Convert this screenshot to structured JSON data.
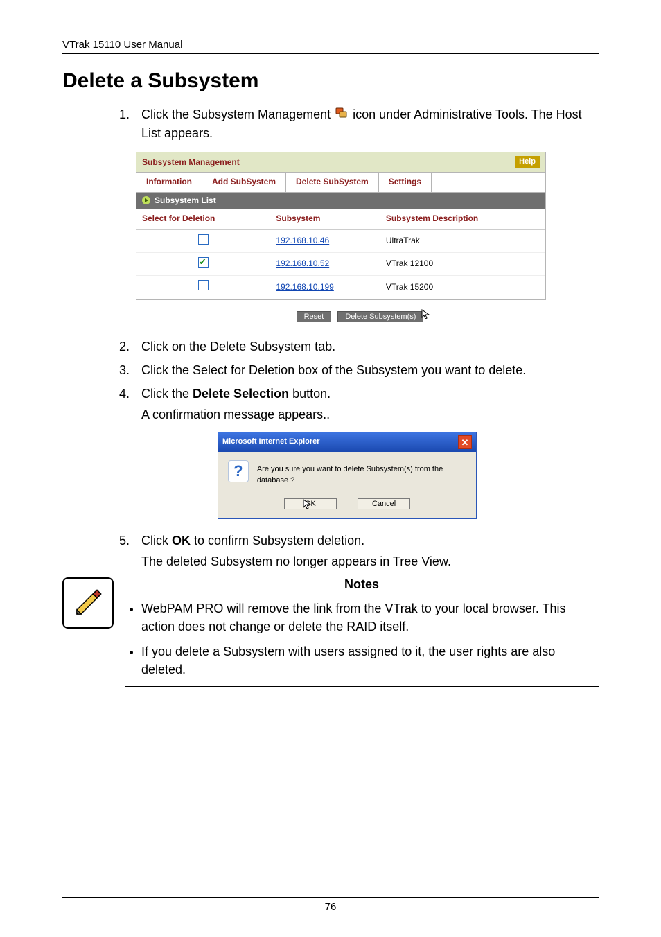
{
  "header": {
    "manual_title": "VTrak 15110 User Manual"
  },
  "section": {
    "title": "Delete a Subsystem"
  },
  "steps": {
    "s1_pre": "Click the Subsystem Management ",
    "s1_post": " icon under Administrative Tools. The Host List appears.",
    "s2": "Click on the Delete Subsystem tab.",
    "s3": "Click the Select for Deletion box of the Subsystem you want to delete.",
    "s4_a": "Click the ",
    "s4_b": "Delete Selection",
    "s4_c": " button.",
    "s4_sub": "A confirmation message appears..",
    "s5_a": "Click ",
    "s5_b": "OK",
    "s5_c": " to confirm Subsystem deletion.",
    "s5_sub": "The deleted Subsystem no longer appears in Tree View."
  },
  "panel": {
    "title": "Subsystem Management",
    "help": "Help",
    "tabs": {
      "info": "Information",
      "add": "Add SubSystem",
      "del": "Delete SubSystem",
      "settings": "Settings"
    },
    "listbar": "Subsystem List",
    "cols": {
      "select": "Select for Deletion",
      "subsystem": "Subsystem",
      "desc": "Subsystem Description"
    },
    "rows": [
      {
        "checked": false,
        "ip": "192.168.10.46",
        "desc": "UltraTrak"
      },
      {
        "checked": true,
        "ip": "192.168.10.52",
        "desc": "VTrak 12100"
      },
      {
        "checked": false,
        "ip": "192.168.10.199",
        "desc": "VTrak 15200"
      }
    ],
    "buttons": {
      "reset": "Reset",
      "delete": "Delete Subsystem(s)"
    }
  },
  "dialog": {
    "title": "Microsoft Internet Explorer",
    "message": "Are you sure you want to delete Subsystem(s) from the database ?",
    "ok": "OK",
    "cancel": "Cancel"
  },
  "notes": {
    "title": "Notes",
    "n1": "WebPAM PRO will remove the link from the VTrak to your local browser. This action does not change or delete the RAID itself.",
    "n2": "If you delete a Subsystem with users assigned to it, the user rights are also deleted."
  },
  "footer": {
    "page": "76"
  }
}
